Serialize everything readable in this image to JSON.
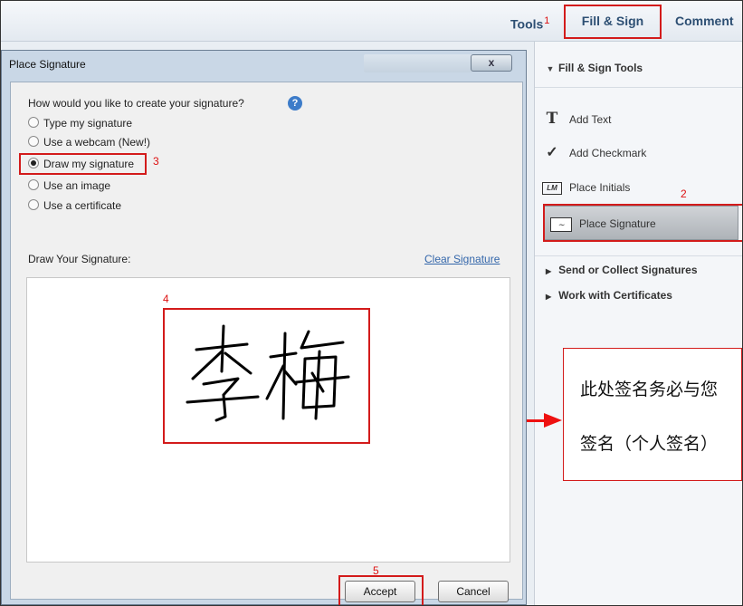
{
  "toolbar": {
    "tools_label": "Tools",
    "tools_marker": "1",
    "fill_sign_label": "Fill & Sign",
    "comment_label": "Comment"
  },
  "right_panel": {
    "section_title": "Fill & Sign Tools",
    "items": [
      {
        "icon": "T",
        "label": "Add Text"
      },
      {
        "icon": "✓",
        "label": "Add Checkmark"
      },
      {
        "icon": "LM",
        "label": "Place Initials"
      },
      {
        "icon": "signature-icon",
        "label": "Place Signature"
      }
    ],
    "place_signature_marker": "2",
    "subsections": [
      "Send or Collect Signatures",
      "Work with Certificates"
    ]
  },
  "note": {
    "line1": "此处签名务必与您",
    "line2": "签名（个人签名）"
  },
  "dialog": {
    "title": "Place Signature",
    "close_label": "x",
    "question": "How would you like to create your signature?",
    "options": [
      {
        "label": "Type my signature",
        "selected": false
      },
      {
        "label": "Use a webcam (New!)",
        "selected": false
      },
      {
        "label": "Draw my signature",
        "selected": true
      },
      {
        "label": "Use an image",
        "selected": false
      },
      {
        "label": "Use a certificate",
        "selected": false
      }
    ],
    "draw_marker": "3",
    "draw_label": "Draw Your Signature:",
    "clear_label": "Clear Signature",
    "canvas_marker": "4",
    "accept_marker": "5",
    "accept_label": "Accept",
    "cancel_label": "Cancel"
  },
  "colors": {
    "annotation_red": "#d31b1b",
    "link_blue": "#3366aa",
    "tab_text": "#2d4f73"
  }
}
